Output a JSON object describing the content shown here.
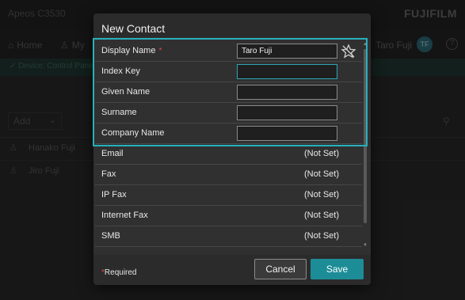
{
  "background": {
    "app_title": "Apeos C3530",
    "brand": "FUJIFILM",
    "nav": {
      "home_label": "Home",
      "my_label": "My",
      "user_name": "Taro Fuji",
      "user_initials": "TF",
      "help_glyph": "?"
    },
    "status_text": "Device: Control Panel",
    "add_label": "Add",
    "contacts": [
      "Hanako Fuji",
      "Jiro Fuji"
    ]
  },
  "dialog": {
    "title": "New Contact",
    "required_fields": [
      {
        "label": "Display Name",
        "required": true,
        "value": "Taro Fuji"
      },
      {
        "label": "Index Key",
        "required": false,
        "value": ""
      },
      {
        "label": "Given Name",
        "required": false,
        "value": ""
      },
      {
        "label": "Surname",
        "required": false,
        "value": ""
      },
      {
        "label": "Company Name",
        "required": false,
        "value": ""
      }
    ],
    "required_marker": "*",
    "address_rows": [
      {
        "label": "Email",
        "value": "(Not Set)"
      },
      {
        "label": "Fax",
        "value": "(Not Set)"
      },
      {
        "label": "IP Fax",
        "value": "(Not Set)"
      },
      {
        "label": "Internet Fax",
        "value": "(Not Set)"
      },
      {
        "label": "SMB",
        "value": "(Not Set)"
      }
    ],
    "footer": {
      "required_note": "Required",
      "cancel_label": "Cancel",
      "save_label": "Save"
    }
  },
  "colors": {
    "accent": "#27b0bb",
    "save_button": "#1c8d97",
    "required_star": "#e0434b"
  },
  "icons": [
    "home-icon",
    "person-icon",
    "help-icon",
    "search-icon",
    "chevron-down-icon",
    "favorite-star-icon",
    "scroll-up-icon",
    "scroll-down-icon"
  ]
}
